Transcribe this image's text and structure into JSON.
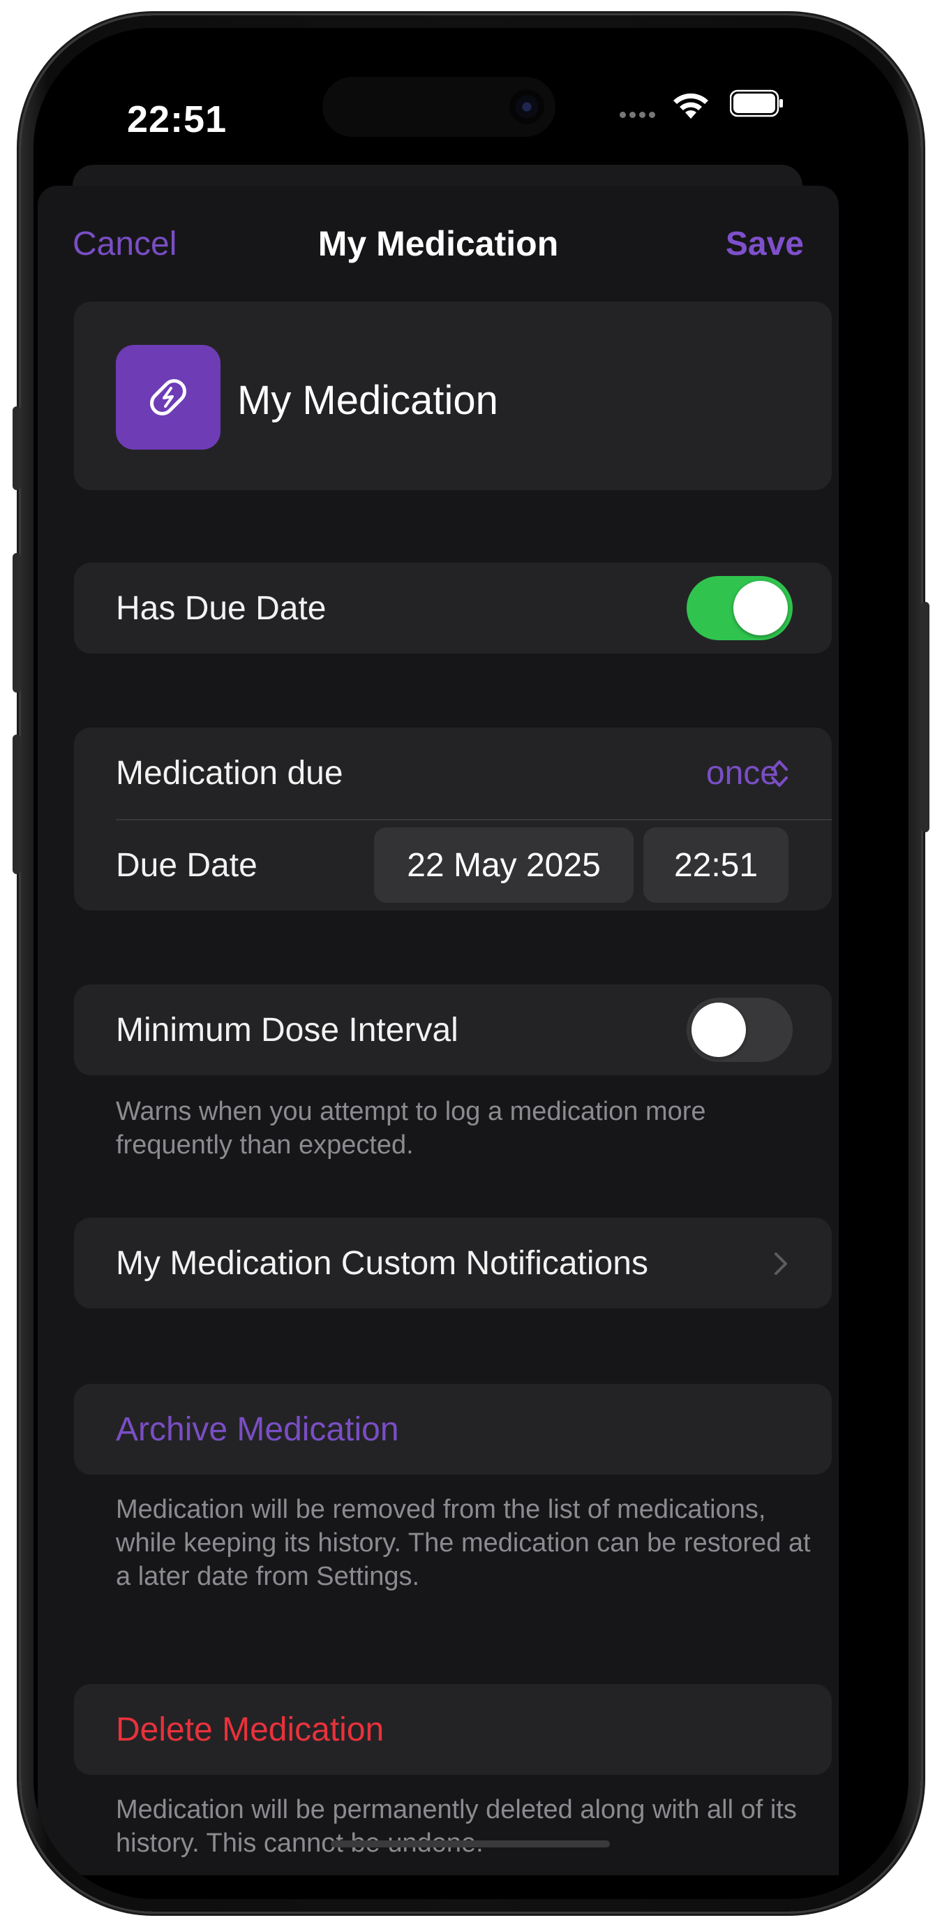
{
  "status": {
    "time": "22:51"
  },
  "nav": {
    "cancel_label": "Cancel",
    "title": "My Medication",
    "save_label": "Save"
  },
  "medication": {
    "name": "My Medication",
    "icon": "pill-icon",
    "icon_color": "#6e3cb5"
  },
  "has_due_date": {
    "label": "Has Due Date",
    "enabled": true
  },
  "schedule": {
    "due_label": "Medication due",
    "due_value": "once",
    "date_label": "Due Date",
    "date_value": "22 May 2025",
    "time_value": "22:51"
  },
  "min_dose": {
    "label": "Minimum Dose Interval",
    "enabled": false,
    "footer": "Warns when you attempt to log a medication more frequently than expected."
  },
  "notifications": {
    "label": "My Medication Custom Notifications"
  },
  "archive": {
    "label": "Archive Medication",
    "footer": "Medication will be removed from the list of medications, while keeping its history. The medication can be restored at a later date from Settings."
  },
  "delete": {
    "label": "Delete Medication",
    "footer": "Medication will be permanently deleted along with all of its history. This cannot be undone."
  },
  "colors": {
    "accent": "#7a4ec4",
    "toggle_on": "#30c44f",
    "destructive": "#e8323c",
    "background": "#161618",
    "card": "#232325"
  }
}
